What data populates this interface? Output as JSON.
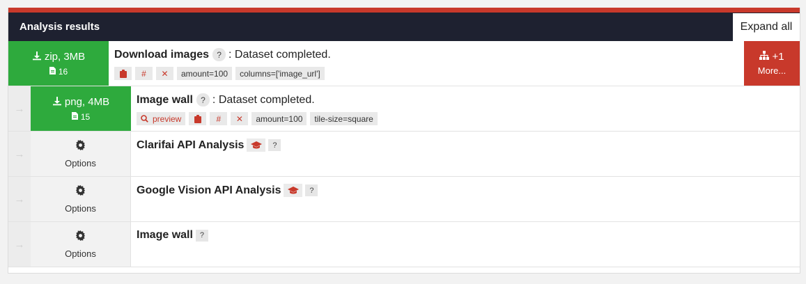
{
  "header": {
    "title": "Analysis results",
    "expand_label": "Expand all"
  },
  "main": {
    "download_format": "zip, 3MB",
    "file_count": "16",
    "name": "Download images",
    "help": "?",
    "status": ": Dataset completed.",
    "tags": [
      "amount=100",
      "columns=['image_url']"
    ],
    "more_count": "+1",
    "more_label": "More..."
  },
  "children": [
    {
      "download_format": "png, 4MB",
      "file_count": "15",
      "name": "Image wall",
      "help": "?",
      "status": ": Dataset completed.",
      "preview_label": "preview",
      "tags": [
        "amount=100",
        "tile-size=square"
      ]
    },
    {
      "options_label": "Options",
      "name": "Clarifai API Analysis",
      "help": "?"
    },
    {
      "options_label": "Options",
      "name": "Google Vision API Analysis",
      "help": "?"
    },
    {
      "options_label": "Options",
      "name": "Image wall",
      "help": "?"
    }
  ],
  "colors": {
    "accent_red": "#c8392b",
    "download_green": "#2eaa3d",
    "header_dark": "#1e2130"
  },
  "icons": [
    "download-icon",
    "file-icon",
    "clipboard-icon",
    "hash-icon",
    "close-icon",
    "sitemap-icon",
    "search-icon",
    "gear-icon",
    "graduation-cap-icon",
    "arrow-right-icon"
  ]
}
